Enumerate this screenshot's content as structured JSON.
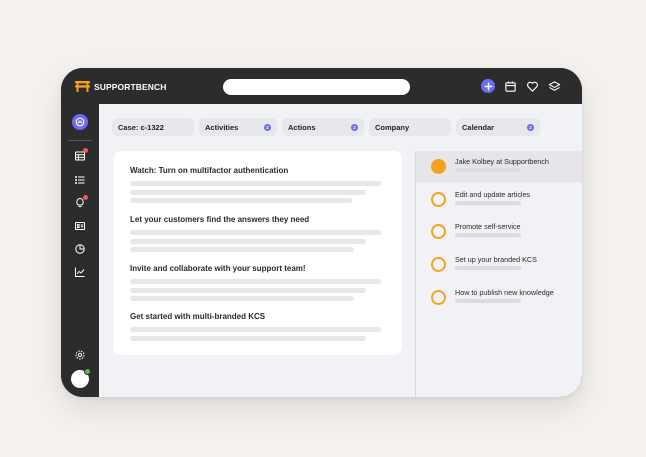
{
  "brand": {
    "name": "SUPPORTBENCH",
    "accent": "#6b6cf0",
    "logo_color": "#f5a11c"
  },
  "topbar": {
    "search_placeholder": "",
    "icons": [
      "plus-icon",
      "calendar-icon",
      "heart-icon",
      "layers-icon"
    ]
  },
  "sidebar": {
    "icons": [
      "home-icon",
      "table-icon",
      "list-icon",
      "lightbulb-icon",
      "id-card-icon",
      "pie-chart-icon",
      "line-chart-icon",
      "settings-icon"
    ]
  },
  "tabs": [
    {
      "label": "Case: c-1322",
      "badge": ""
    },
    {
      "label": "Activities",
      "badge": "2"
    },
    {
      "label": "Actions",
      "badge": "2"
    },
    {
      "label": "Company",
      "badge": ""
    },
    {
      "label": "Calendar",
      "badge": "2"
    }
  ],
  "card": {
    "sections": [
      {
        "title": "Watch: Turn on multifactor authentication"
      },
      {
        "title": "Let your customers find the answers they need"
      },
      {
        "title": "Invite and collaborate with your support team!"
      },
      {
        "title": "Get started with multi-branded KCS"
      }
    ]
  },
  "checklist": {
    "items": [
      {
        "label": "Jake Kolbey at Supportbench",
        "done": true
      },
      {
        "label": "Edit and update articles",
        "done": false
      },
      {
        "label": "Promote self-service",
        "done": false
      },
      {
        "label": "Set up your branded KCS",
        "done": false
      },
      {
        "label": "How to publish new knowledge",
        "done": false
      }
    ]
  }
}
